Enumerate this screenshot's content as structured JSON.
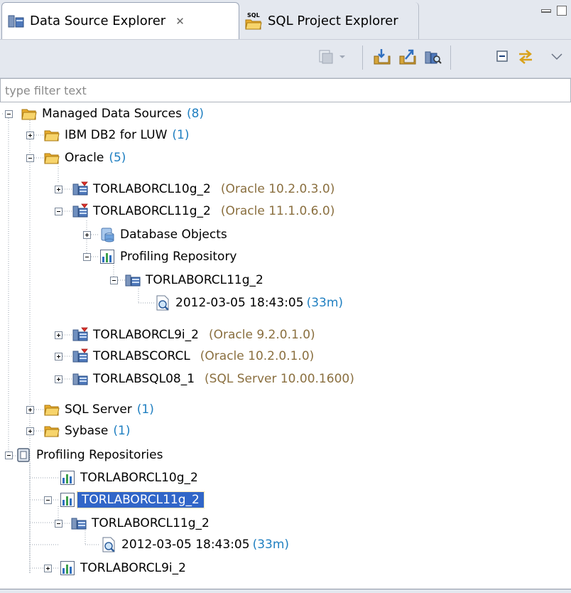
{
  "tabs": {
    "data_source_explorer": "Data Source Explorer",
    "sql_project_explorer": "SQL Project Explorer",
    "sql_badge": "SQL",
    "close_glyph": "✕"
  },
  "filter": {
    "placeholder": "type filter text",
    "value": ""
  },
  "toolbar": {
    "icons": [
      "collapse-dropdown-icon",
      "import-icon",
      "export-icon",
      "database-search-icon",
      "collapse-all-icon",
      "link-with-editor-icon",
      "view-menu-icon"
    ]
  },
  "tree": {
    "managed": {
      "label": "Managed Data Sources",
      "count": "(8)"
    },
    "db2": {
      "label": "IBM DB2 for LUW",
      "count": "(1)"
    },
    "oracle": {
      "label": "Oracle",
      "count": "(5)"
    },
    "ora10": {
      "label": "TORLABORCL10g_2",
      "detail": "(Oracle 10.2.0.3.0)"
    },
    "ora11": {
      "label": "TORLABORCL11g_2",
      "detail": "(Oracle 11.1.0.6.0)"
    },
    "db_objects": {
      "label": "Database Objects"
    },
    "profiling_repo": {
      "label": "Profiling Repository"
    },
    "repo_conn": {
      "label": "TORLABORCL11g_2"
    },
    "repo_run": {
      "label": "2012-03-05 18:43:05",
      "count": "(33m)"
    },
    "ora9": {
      "label": "TORLABORCL9i_2",
      "detail": "(Oracle 9.2.0.1.0)"
    },
    "scorcl": {
      "label": "TORLABSCORCL",
      "detail": "(Oracle 10.2.0.1.0)"
    },
    "sql08": {
      "label": "TORLABSQL08_1",
      "detail": "(SQL Server 10.00.1600)"
    },
    "sqlserver": {
      "label": "SQL Server",
      "count": "(1)"
    },
    "sybase": {
      "label": "Sybase",
      "count": "(1)"
    },
    "profiling_repos": {
      "label": "Profiling Repositories"
    },
    "pr10": {
      "label": "TORLABORCL10g_2"
    },
    "pr11": {
      "label": "TORLABORCL11g_2"
    },
    "pr11_conn": {
      "label": "TORLABORCL11g_2"
    },
    "pr11_run": {
      "label": "2012-03-05 18:43:05",
      "count": "(33m)"
    },
    "pr9": {
      "label": "TORLABORCL9i_2"
    }
  },
  "colors": {
    "selection": "#3166c8",
    "count": "#1f7fc1",
    "detail": "#8a6f3f",
    "folder": "#f3c24a"
  }
}
